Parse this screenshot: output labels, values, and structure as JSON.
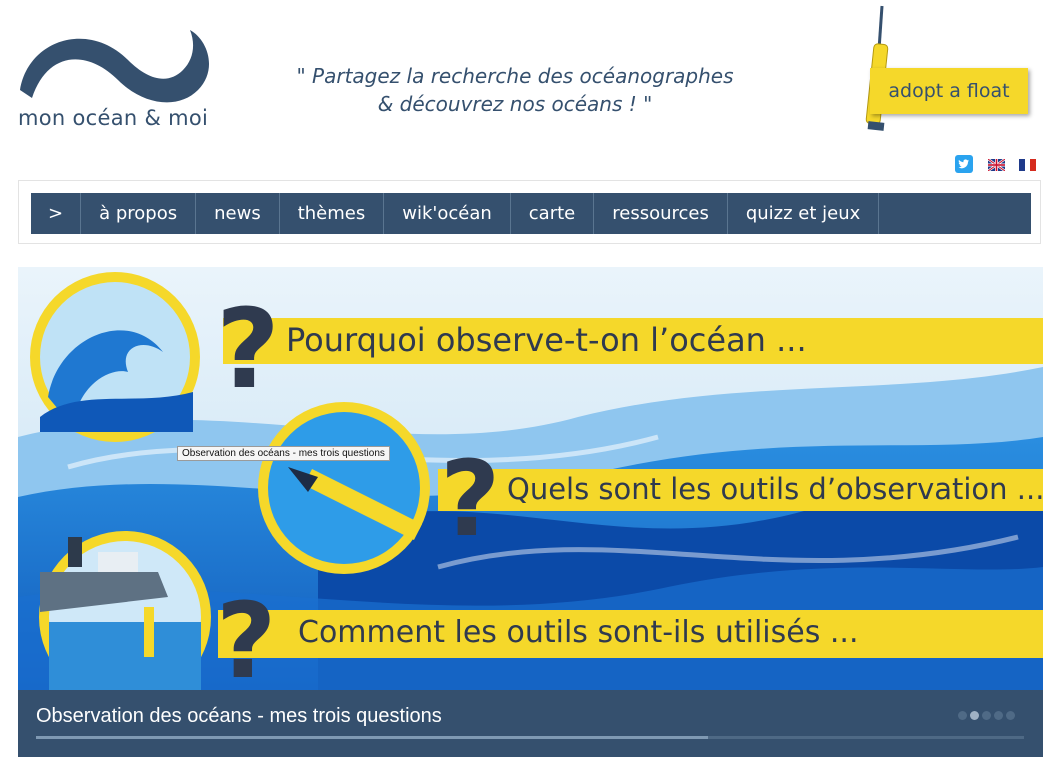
{
  "header": {
    "logo_text": "mon océan & moi",
    "tagline_line1": "\" Partagez la recherche des océanographes",
    "tagline_line2": "& découvrez nos océans ! \"",
    "adopt_label": "adopt a float"
  },
  "social": {
    "icons": [
      "twitter-icon",
      "flag-uk-icon",
      "flag-fr-icon"
    ]
  },
  "nav": {
    "items": [
      ">",
      "à propos",
      "news",
      "thèmes",
      "wik'océan",
      "carte",
      "ressources",
      "quizz et jeux"
    ]
  },
  "slider": {
    "question1": "Pourquoi observe-t-on l’océan ...",
    "question2": "Quels sont les outils d’observation ...",
    "question3": "Comment les outils sont-ils utilisés ...",
    "tooltip": "Observation des océans -  mes trois questions",
    "caption": "Observation des océans - mes trois questions",
    "active_slide": 2,
    "slide_count": 5,
    "progress": 0.68
  },
  "colors": {
    "navy": "#35506e",
    "yellow": "#f5d82a",
    "ocean_blue": "#1565c0",
    "sky": "#cfe6f6"
  }
}
